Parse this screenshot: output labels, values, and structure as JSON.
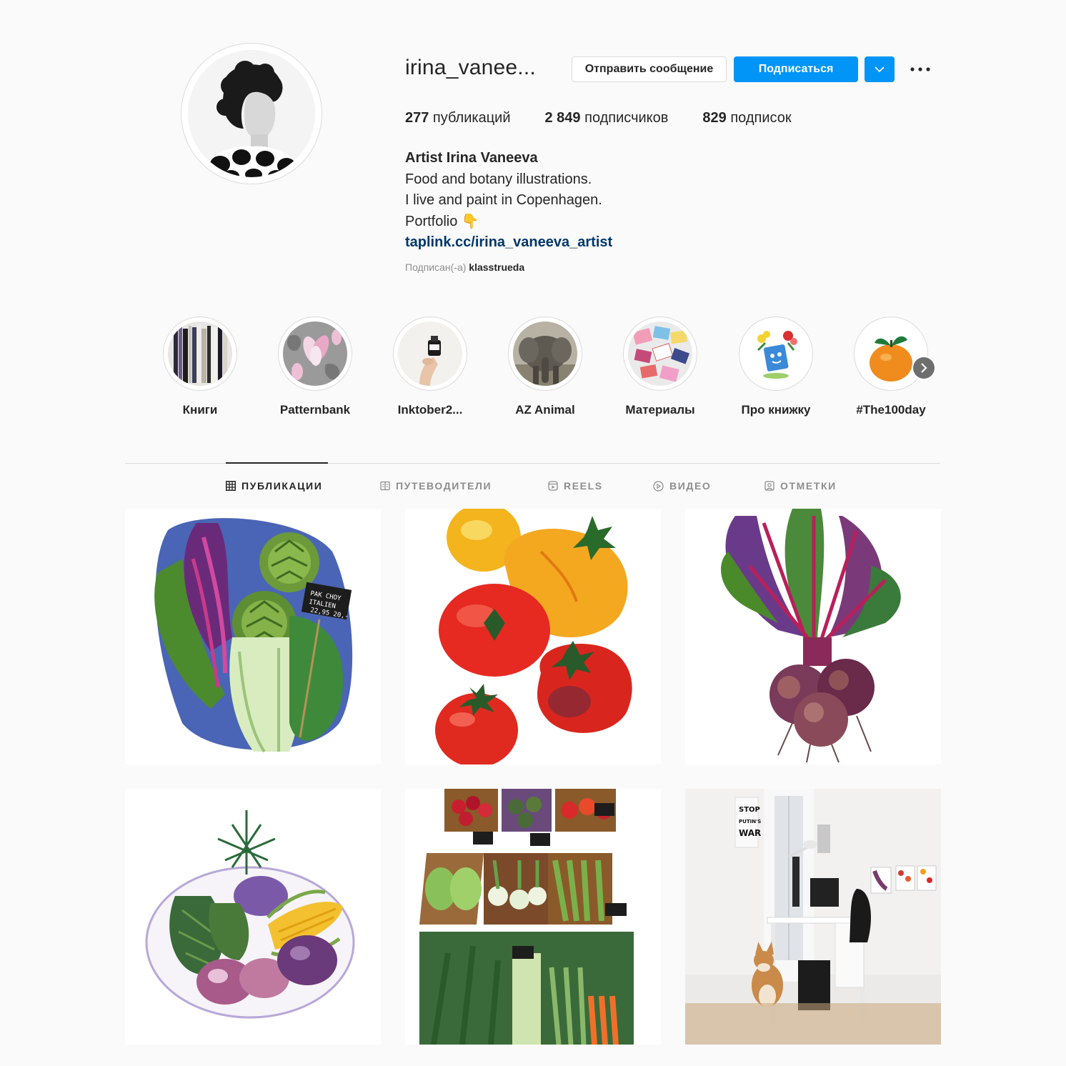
{
  "profile": {
    "username": "irina_vanee...",
    "message_button": "Отправить сообщение",
    "follow_button": "Подписаться",
    "stats": {
      "posts_count": "277",
      "posts_label": " публикаций",
      "followers_count": "2 849",
      "followers_label": " подписчиков",
      "following_count": "829",
      "following_label": " подписок"
    },
    "bio": {
      "name": "Artist Irina Vaneeva",
      "line1": "Food and botany illustrations.",
      "line2": "I live and paint in Copenhagen.",
      "line3": "Portfolio 👇",
      "link": "taplink.cc/irina_vaneeva_artist"
    },
    "followed_by_prefix": "Подписан(-а) ",
    "followed_by_user": "klasstrueda"
  },
  "highlights": [
    {
      "label": "Книги",
      "icon": "books-highlight"
    },
    {
      "label": "Patternbank",
      "icon": "magnolia-highlight"
    },
    {
      "label": "Inktober2...",
      "icon": "ink-bottle-highlight"
    },
    {
      "label": "AZ Animal",
      "icon": "elephant-highlight"
    },
    {
      "label": "Материалы",
      "icon": "materials-highlight"
    },
    {
      "label": "Про книжку",
      "icon": "book-character-highlight"
    },
    {
      "label": "#The100day",
      "icon": "tangerine-highlight"
    }
  ],
  "tabs": [
    {
      "label": "ПУБЛИКАЦИИ",
      "icon": "grid-icon",
      "active": true
    },
    {
      "label": "ПУТЕВОДИТЕЛИ",
      "icon": "guide-icon",
      "active": false
    },
    {
      "label": "REELS",
      "icon": "reels-icon",
      "active": false
    },
    {
      "label": "ВИДЕО",
      "icon": "video-icon",
      "active": false
    },
    {
      "label": "ОТМЕТКИ",
      "icon": "tagged-icon",
      "active": false
    }
  ],
  "posts": [
    {
      "subject": "pak-choi-artichoke-illustration",
      "sign_text": "PAK CHOY ITALIEN 22,95 20,-"
    },
    {
      "subject": "tomatoes-illustration"
    },
    {
      "subject": "beetroot-illustration"
    },
    {
      "subject": "vegetable-plate-illustration"
    },
    {
      "subject": "market-stall-illustration"
    },
    {
      "subject": "studio-photo",
      "poster_text": "STOP PUTIN'S WAR"
    }
  ],
  "colors": {
    "accent": "#0095f6",
    "link": "#00376b",
    "background": "#fafafa",
    "border": "#dbdbdb",
    "muted": "#8e8e8e"
  }
}
